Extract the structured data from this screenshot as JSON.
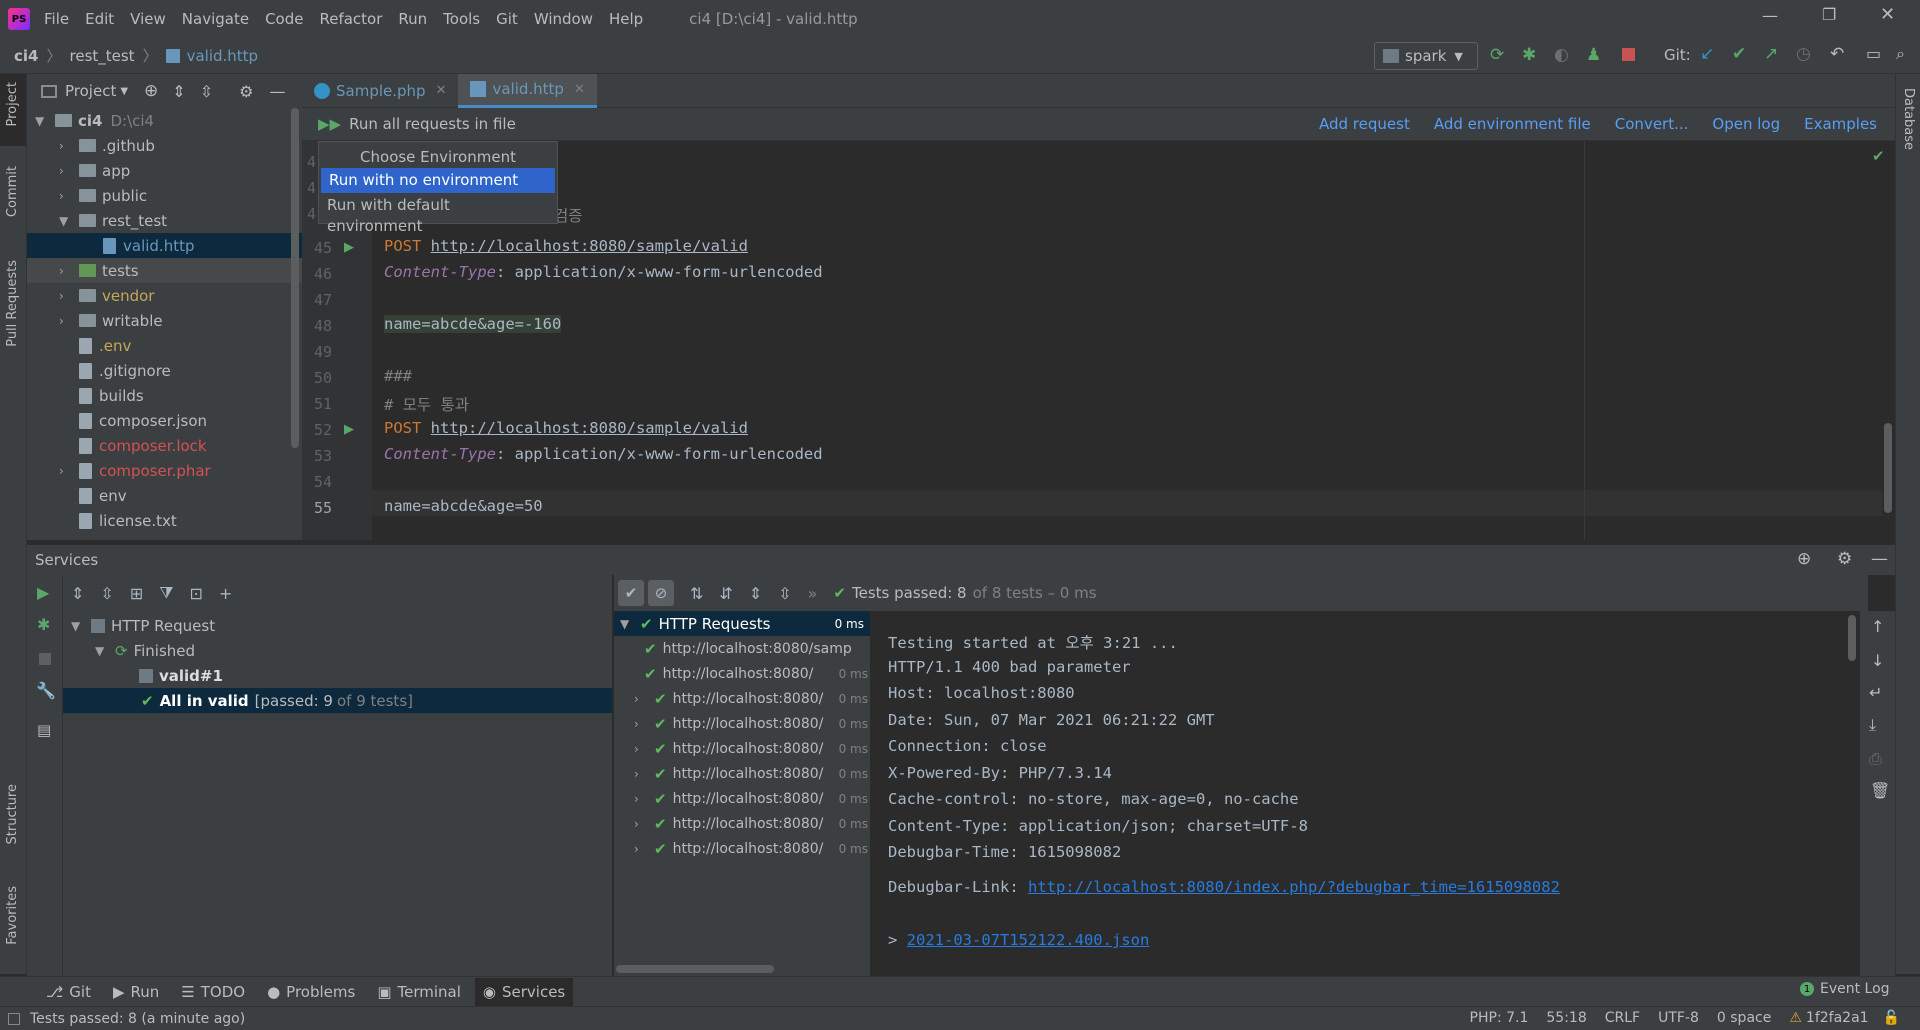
{
  "window": {
    "title": "ci4 [D:\\ci4] - valid.http",
    "menu": [
      "File",
      "Edit",
      "View",
      "Navigate",
      "Code",
      "Refactor",
      "Run",
      "Tools",
      "Git",
      "Window",
      "Help"
    ]
  },
  "breadcrumb": {
    "project": "ci4",
    "folder": "rest_test",
    "file": "valid.http"
  },
  "toolbar": {
    "run_config": "spark",
    "git_label": "Git:"
  },
  "project_panel": {
    "title": "Project",
    "root": {
      "name": "ci4",
      "path": "D:\\ci4"
    },
    "items": [
      {
        "name": ".github",
        "type": "folder",
        "color": "#bbbbbb"
      },
      {
        "name": "app",
        "type": "folder",
        "color": "#bbbbbb"
      },
      {
        "name": "public",
        "type": "folder",
        "color": "#bbbbbb"
      },
      {
        "name": "rest_test",
        "type": "folder",
        "color": "#bbbbbb"
      },
      {
        "name": "valid.http",
        "type": "file",
        "color": "#6897bb"
      },
      {
        "name": "tests",
        "type": "folder",
        "color": "#bbbbbb"
      },
      {
        "name": "vendor",
        "type": "folder",
        "color": "#c7a65b"
      },
      {
        "name": "writable",
        "type": "folder",
        "color": "#bbbbbb"
      },
      {
        "name": ".env",
        "type": "file",
        "color": "#c7a65b"
      },
      {
        "name": ".gitignore",
        "type": "file",
        "color": "#bbbbbb"
      },
      {
        "name": "builds",
        "type": "file",
        "color": "#bbbbbb"
      },
      {
        "name": "composer.json",
        "type": "file",
        "color": "#bbbbbb"
      },
      {
        "name": "composer.lock",
        "type": "file",
        "color": "#d25252"
      },
      {
        "name": "composer.phar",
        "type": "file",
        "color": "#d25252"
      },
      {
        "name": "env",
        "type": "file",
        "color": "#bbbbbb"
      },
      {
        "name": "license.txt",
        "type": "file",
        "color": "#bbbbbb"
      }
    ]
  },
  "editor_tabs": [
    {
      "label": "Sample.php",
      "active": false
    },
    {
      "label": "valid.http",
      "active": true
    }
  ],
  "http_toolbar": {
    "run_all": "Run all requests in file",
    "links": [
      "Add request",
      "Add environment file",
      "Convert...",
      "Open log",
      "Examples"
    ]
  },
  "env_popup": {
    "title": "Choose Environment",
    "options": [
      "Run with no environment",
      "Run with default environment"
    ]
  },
  "code": {
    "fragment_comment": "검증",
    "lines": [
      {
        "n": "45",
        "method": "POST",
        "url": "http://localhost:8080/sample/valid"
      },
      {
        "n": "46",
        "header": "Content-Type",
        "value": ": application/x-www-form-urlencoded"
      },
      {
        "n": "47"
      },
      {
        "n": "48",
        "body": "name=abcde&age=-160"
      },
      {
        "n": "49"
      },
      {
        "n": "50",
        "text": "###"
      },
      {
        "n": "51",
        "text": "# 모두 통과"
      },
      {
        "n": "52",
        "method": "POST",
        "url": "http://localhost:8080/sample/valid"
      },
      {
        "n": "53",
        "header": "Content-Type",
        "value": ": application/x-www-form-urlencoded"
      },
      {
        "n": "54"
      },
      {
        "n": "55",
        "body": "name=abcde&age=50"
      }
    ]
  },
  "services": {
    "title": "Services",
    "tree": [
      {
        "label": "HTTP Request"
      },
      {
        "label": "Finished"
      },
      {
        "label": "valid#1"
      },
      {
        "label": "All in valid",
        "suffix": "[passed: 9",
        "suffix2": "of 9 tests]"
      }
    ],
    "tests_passed": "Tests passed: 8",
    "tests_suffix": "of 8 tests – 0 ms",
    "test_root": {
      "label": "HTTP Requests",
      "time": "0 ms"
    },
    "test_items": [
      {
        "label": "http://localhost:8080/samp",
        "time": ""
      },
      {
        "label": "http://localhost:8080/",
        "time": "0 ms"
      },
      {
        "label": "http://localhost:8080/",
        "time": "0 ms"
      },
      {
        "label": "http://localhost:8080/",
        "time": "0 ms"
      },
      {
        "label": "http://localhost:8080/",
        "time": "0 ms"
      },
      {
        "label": "http://localhost:8080/",
        "time": "0 ms"
      },
      {
        "label": "http://localhost:8080/",
        "time": "0 ms"
      },
      {
        "label": "http://localhost:8080/",
        "time": "0 ms"
      },
      {
        "label": "http://localhost:8080/",
        "time": "0 ms"
      }
    ],
    "console": [
      "Testing started at 오후 3:21 ...",
      "HTTP/1.1 400 bad parameter",
      "Host: localhost:8080",
      "Date: Sun, 07 Mar 2021 06:21:22 GMT",
      "Connection: close",
      "X-Powered-By: PHP/7.3.14",
      "Cache-control: no-store, max-age=0, no-cache",
      "Content-Type: application/json; charset=UTF-8",
      "Debugbar-Time: 1615098082"
    ],
    "debugbar_label": "Debugbar-Link: ",
    "debugbar_link": "http://localhost:8080/index.php/?debugbar_time=1615098082",
    "json_prefix": "> ",
    "json_link": "2021-03-07T152122.400.json"
  },
  "left_strip": [
    "Project",
    "Commit",
    "Pull Requests",
    "Structure",
    "Favorites"
  ],
  "right_strip": [
    "Database"
  ],
  "bottom_tabs": [
    "Git",
    "Run",
    "TODO",
    "Problems",
    "Terminal",
    "Services"
  ],
  "event_log": "Event Log",
  "status": {
    "message": "Tests passed: 8 (a minute ago)",
    "php": "PHP: 7.1",
    "pos": "55:18",
    "eol": "CRLF",
    "enc": "UTF-8",
    "indent": "0 space",
    "branch": "1f2fa2a1"
  }
}
